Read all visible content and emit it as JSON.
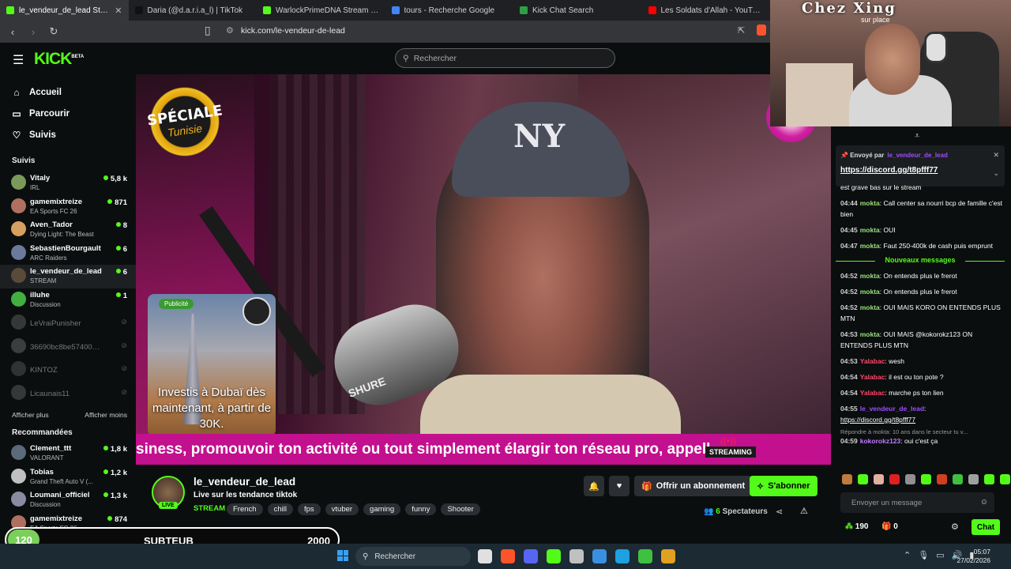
{
  "browser": {
    "tabs": [
      {
        "label": "le_vendeur_de_lead Stream - W",
        "color": "#53fc18",
        "active": true
      },
      {
        "label": "Daria (@d.a.r.i.a_l) | TikTok",
        "color": "#111111"
      },
      {
        "label": "WarlockPrimeDNA Stream - Watch l",
        "color": "#53fc18"
      },
      {
        "label": "tours - Recherche Google",
        "color": "#4285f4"
      },
      {
        "label": "Kick Chat Search",
        "color": "#2ea043"
      },
      {
        "label": "Les Soldats d'Allah - YouTube",
        "color": "#ff0000"
      }
    ],
    "url": "kick.com/le-vendeur-de-lead"
  },
  "header": {
    "logo": "KICK",
    "logo_tag": "BETA",
    "search_placeholder": "Rechercher"
  },
  "sidebar": {
    "nav": [
      {
        "label": "Accueil",
        "icon": "home-icon",
        "glyph": "⌂"
      },
      {
        "label": "Parcourir",
        "icon": "browse-icon",
        "glyph": "▭"
      },
      {
        "label": "Suivis",
        "icon": "heart-icon",
        "glyph": "♡"
      }
    ],
    "following_title": "Suivis",
    "following": [
      {
        "name": "Vitaly",
        "game": "IRL",
        "viewers": "5,8 k",
        "color": "#7a9a5a"
      },
      {
        "name": "gamemixtreize",
        "game": "EA Sports FC 26",
        "viewers": "871",
        "color": "#b07060"
      },
      {
        "name": "Aven_Tador",
        "game": "Dying Light: The Beast",
        "viewers": "8",
        "color": "#d8a060"
      },
      {
        "name": "SebastienBourgault",
        "game": "ARC Raiders",
        "viewers": "6",
        "color": "#6a7a9a"
      },
      {
        "name": "le_vendeur_de_lead",
        "game": "STREAM",
        "viewers": "6",
        "color": "#5a4a3a"
      },
      {
        "name": "illuhe",
        "game": "Discussion",
        "viewers": "1",
        "color": "#40b040"
      }
    ],
    "offline": [
      {
        "name": "LeVraiPunisher",
        "color": "#888888"
      },
      {
        "name": "36690bc8be574004a...",
        "color": "#999999"
      },
      {
        "name": "KINTOZ",
        "color": "#777777"
      },
      {
        "name": "Licaunais11",
        "color": "#888888"
      }
    ],
    "show_more": "Afficher plus",
    "show_less": "Afficher moins",
    "recommended_title": "Recommandées",
    "recommended": [
      {
        "name": "Clement_ttt",
        "game": "VALORANT",
        "viewers": "1,8 k",
        "color": "#5a6a7a"
      },
      {
        "name": "Tobias",
        "game": "Grand Theft Auto V (...",
        "viewers": "1,2 k",
        "color": "#c0c0c0"
      },
      {
        "name": "Loumani_officiel",
        "game": "Discussion",
        "viewers": "1,3 k",
        "color": "#8a8aa0"
      },
      {
        "name": "gamemixtreize",
        "game": "EA Sports FC 26",
        "viewers": "874",
        "color": "#b07060"
      }
    ]
  },
  "player": {
    "badge_line1": "SPÉCIALE",
    "badge_line2": "Tunisie",
    "cap_text": "NY",
    "mic_brand": "SHURE",
    "ad_tag": "Publicité",
    "ad_text": "Investis à Dubaï dès maintenant, à partir de 30K.",
    "ticker_text": "siness, promouvoir ton activité ou tout simplement élargir ton réseau pro, appell",
    "ticker_badge": "STREAMING"
  },
  "channel": {
    "name": "le_vendeur_de_lead",
    "title": "Live sur les tendance tiktok",
    "category": "STREAM",
    "live": "LIVE",
    "tags": [
      "French",
      "chill",
      "fps",
      "vtuber",
      "gaming",
      "funny",
      "Shooter"
    ],
    "gift_label": "Offrir un abonnement",
    "subscribe_label": "S'abonner",
    "viewers_count": "6",
    "viewers_label": "Spectateurs"
  },
  "subgoal": {
    "current": "120",
    "label": "SUBTEUB",
    "target": "2000",
    "progress": 0.06
  },
  "webcam": {
    "sign": "Chez Xing",
    "sub": "sur place"
  },
  "chat": {
    "pinned_by": "Envoyé par",
    "pinned_user": "le_vendeur_de_lead",
    "pinned_link": "https://discord.gg/t8pfff77",
    "partial": "est grave bas sur le stream",
    "messages_before": [
      {
        "time": "04:44",
        "user": "mokta",
        "color": "#9ae07a",
        "text": "Call center sa nourri bcp de famille c'est bien"
      },
      {
        "time": "04:45",
        "user": "mokta",
        "color": "#9ae07a",
        "text": "OUI"
      },
      {
        "time": "04:47",
        "user": "mokta",
        "color": "#9ae07a",
        "text": "Faut 250-400k de cash puis emprunt"
      }
    ],
    "new_messages": "Nouveaux messages",
    "messages_after": [
      {
        "time": "04:52",
        "user": "mokta",
        "color": "#9ae07a",
        "text": "On entends plus le frerot"
      },
      {
        "time": "04:52",
        "user": "mokta",
        "color": "#9ae07a",
        "text": "On entends plus le frerot"
      },
      {
        "time": "04:52",
        "user": "mokta",
        "color": "#9ae07a",
        "text": "OUI MAIS KORO ON ENTENDS PLUS MTN"
      },
      {
        "time": "04:53",
        "user": "mokta",
        "color": "#9ae07a",
        "text": "OUI MAIS @kokorokz123 ON ENTENDS PLUS MTN"
      },
      {
        "time": "04:53",
        "user": "Yalabac",
        "color": "#ff4a6a",
        "text": "wesh"
      },
      {
        "time": "04:54",
        "user": "Yalabac",
        "color": "#ff4a6a",
        "text": "il est ou ton pote ?"
      },
      {
        "time": "04:54",
        "user": "Yalabac",
        "color": "#ff4a6a",
        "text": "marche ps ton lien"
      },
      {
        "time": "04:55",
        "user": "le_vendeur_de_lead",
        "color": "#9d4cff",
        "text": "https://discord.gg/t8pfff77"
      }
    ],
    "reply_hint": "Répondre à mokta: 10 ans dans le secteur tu v...",
    "last": {
      "time": "04:59",
      "user": "kokorokz123",
      "color": "#c07aff",
      "text": "oui c'est ça"
    },
    "emote_colors": [
      "#c07a40",
      "#53fc18",
      "#e0b0a0",
      "#e02020",
      "#909090",
      "#53fc18",
      "#d04020",
      "#40c040",
      "#a0a0a0",
      "#53fc18",
      "#53fc18",
      "#53fc18"
    ],
    "input_placeholder": "Envoyer un message",
    "points": "190",
    "drops": "0",
    "send_label": "Chat"
  },
  "taskbar": {
    "search": "Rechercher",
    "app_colors": [
      "#e0e0e0",
      "#fb542b",
      "#5865f2",
      "#53fc18",
      "#c0c0c0",
      "#3a90e0",
      "#1fa0e0",
      "#40c040",
      "#e0a020"
    ],
    "time": "05:07",
    "date": "27/02/2026"
  }
}
